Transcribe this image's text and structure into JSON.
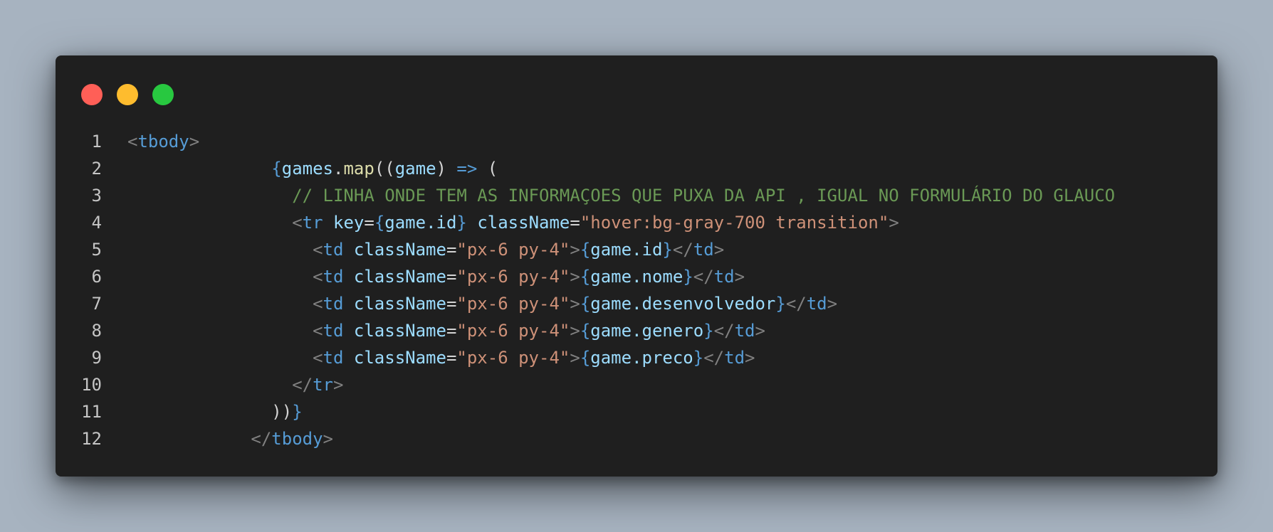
{
  "window": {
    "traffic_lights": [
      "close",
      "minimize",
      "maximize"
    ]
  },
  "code": {
    "lines": [
      {
        "num": "1"
      },
      {
        "num": "2"
      },
      {
        "num": "3"
      },
      {
        "num": "4"
      },
      {
        "num": "5"
      },
      {
        "num": "6"
      },
      {
        "num": "7"
      },
      {
        "num": "8"
      },
      {
        "num": "9"
      },
      {
        "num": "10"
      },
      {
        "num": "11"
      },
      {
        "num": "12"
      }
    ],
    "tokens": {
      "tbody": "tbody",
      "games": "games",
      "dot": ".",
      "map": "map",
      "game": "game",
      "arrow": "=>",
      "open_paren_space": " (",
      "double_paren": "((",
      "close_paren": ")",
      "comment": "// LINHA ONDE TEM AS INFORMAÇOES QUE PUXA DA API , IGUAL NO FORMULÁRIO DO GLAUCO",
      "tr": "tr",
      "td": "td",
      "key": "key",
      "className": "className",
      "eq": "=",
      "tr_class_value": "\"hover:bg-gray-700 transition\"",
      "td_class_value": "\"px-6 py-4\"",
      "game_id": "game.id",
      "game_nome": "game.nome",
      "game_desenvolvedor": "game.desenvolvedor",
      "game_genero": "game.genero",
      "game_preco": "game.preco",
      "close_map": "))"
    }
  },
  "colors": {
    "background": "#a7b3c0",
    "window": "#1f1f1f",
    "light_red": "#ff5f57",
    "light_yellow": "#febc2e",
    "light_green": "#28c840",
    "keyword_blue": "#569cd6",
    "identifier": "#9cdcfe",
    "string": "#ce9178",
    "function": "#dcdcaa",
    "comment": "#6a9955"
  }
}
